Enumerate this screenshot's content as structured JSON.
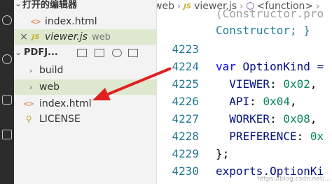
{
  "sidebar": {
    "open_editors_label": "打开的编辑器",
    "open_editors": [
      {
        "name": "index.html",
        "folder": ""
      },
      {
        "name": "viewer.js",
        "folder": "web"
      }
    ],
    "project_label": "PDFJ...",
    "tree": [
      {
        "label": "build"
      },
      {
        "label": "web"
      },
      {
        "label": "index.html"
      },
      {
        "label": "LICENSE"
      }
    ]
  },
  "editor": {
    "breadcrumb": {
      "folder": "web",
      "file": "viewer.js",
      "symbol": "<function>",
      "file_icon": "JS"
    },
    "top_line": "(Constructor.pro",
    "lines": [
      {
        "n": "",
        "text": "Constructor; }"
      },
      {
        "n": "4223",
        "text": ""
      },
      {
        "n": "4224",
        "text": "var OptionKind ="
      },
      {
        "n": "4225",
        "key": "VIEWER",
        "val": "0x02"
      },
      {
        "n": "4226",
        "key": "API",
        "val": "0x04"
      },
      {
        "n": "4227",
        "key": "WORKER",
        "val": "0x08"
      },
      {
        "n": "4228",
        "key": "PREFERENCE",
        "val": "0x"
      },
      {
        "n": "4229",
        "text": "};"
      },
      {
        "n": "4230",
        "text": "exports.OptionKi"
      }
    ],
    "watermark": "https://blog.csdn.net/..."
  },
  "colors": {
    "selected_row": "#dde8cf",
    "keyword": "#0000ff",
    "line_number": "#237893",
    "number": "#098658",
    "arrow": "#e02020"
  }
}
